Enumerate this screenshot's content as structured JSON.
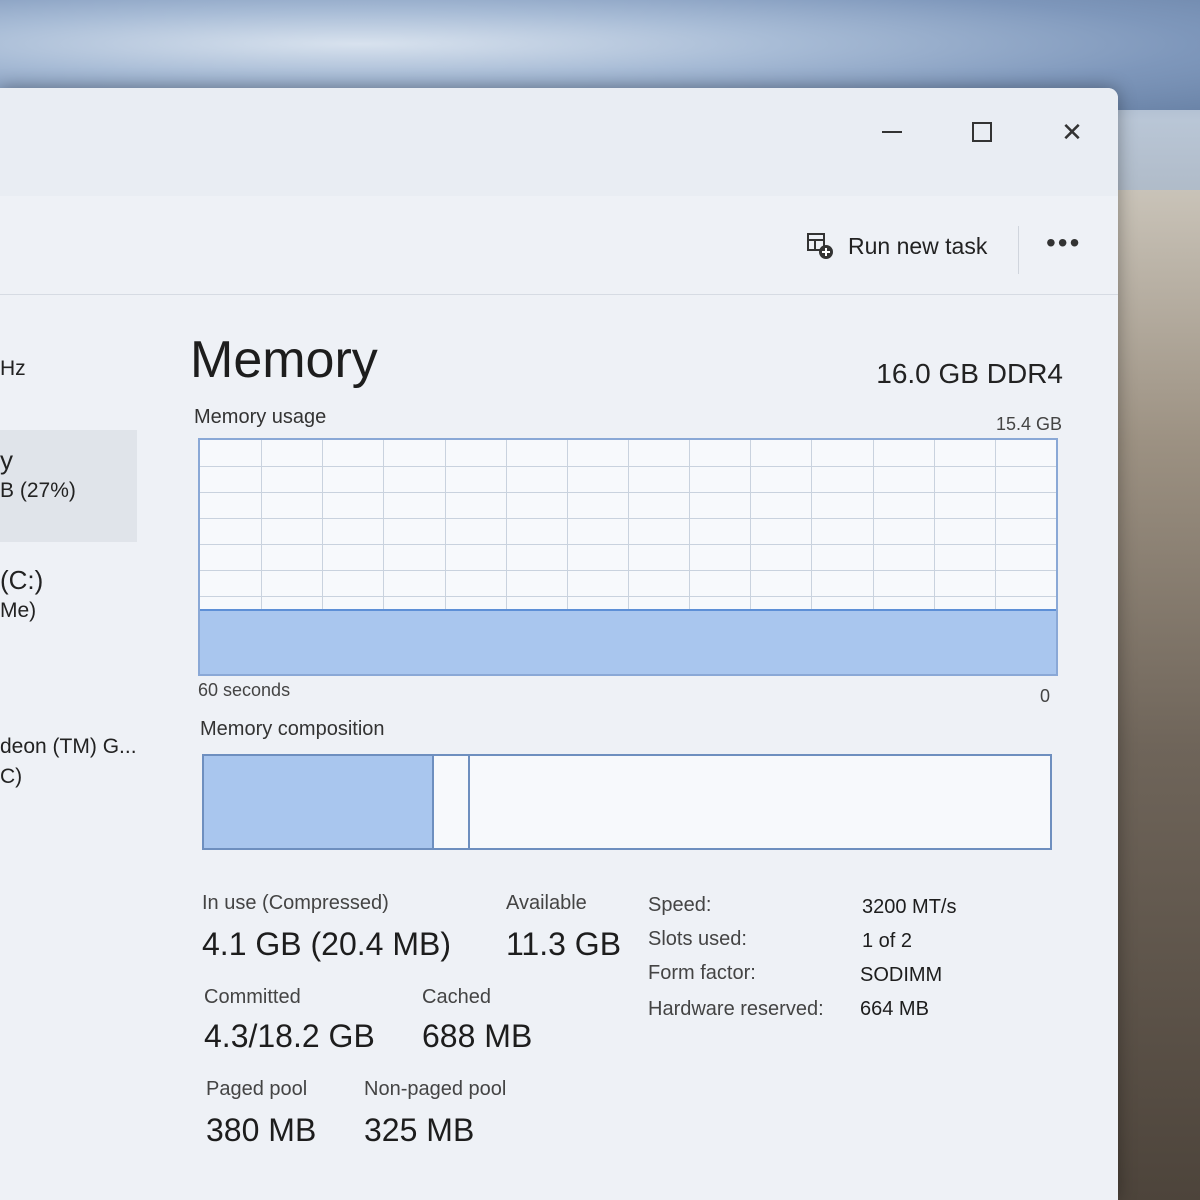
{
  "window_controls": {
    "minimize": "—",
    "maximize": "□",
    "close": "✕"
  },
  "toolbar": {
    "run_new_task": "Run new task",
    "more": "•••"
  },
  "sidebar": {
    "items": [
      {
        "l1": "",
        "l2": "Hz"
      },
      {
        "l1": "y",
        "l2": "B (27%)"
      },
      {
        "l1": "(C:)",
        "l2": "Me)"
      },
      {
        "l1": "deon (TM) G...",
        "l2": "C)"
      }
    ]
  },
  "main": {
    "title": "Memory",
    "spec": "16.0 GB DDR4",
    "usage_label": "Memory usage",
    "usage_max": "15.4 GB",
    "time_label": "60 seconds",
    "time_zero": "0",
    "composition_label": "Memory composition"
  },
  "usage": {
    "fraction": 0.27
  },
  "composition": {
    "in_use_fraction": 0.27,
    "modified_fraction": 0.04
  },
  "stats": {
    "in_use_label": "In use (Compressed)",
    "in_use_value": "4.1 GB (20.4 MB)",
    "available_label": "Available",
    "available_value": "11.3 GB",
    "committed_label": "Committed",
    "committed_value": "4.3/18.2 GB",
    "cached_label": "Cached",
    "cached_value": "688 MB",
    "paged_label": "Paged pool",
    "paged_value": "380 MB",
    "nonpaged_label": "Non-paged pool",
    "nonpaged_value": "325 MB"
  },
  "props": {
    "speed_k": "Speed:",
    "speed_v": "3200 MT/s",
    "slots_k": "Slots used:",
    "slots_v": "1 of 2",
    "form_k": "Form factor:",
    "form_v": "SODIMM",
    "hw_k": "Hardware reserved:",
    "hw_v": "664 MB"
  },
  "colors": {
    "accent": "#5d8fd6",
    "fill": "#a9c6ee"
  }
}
